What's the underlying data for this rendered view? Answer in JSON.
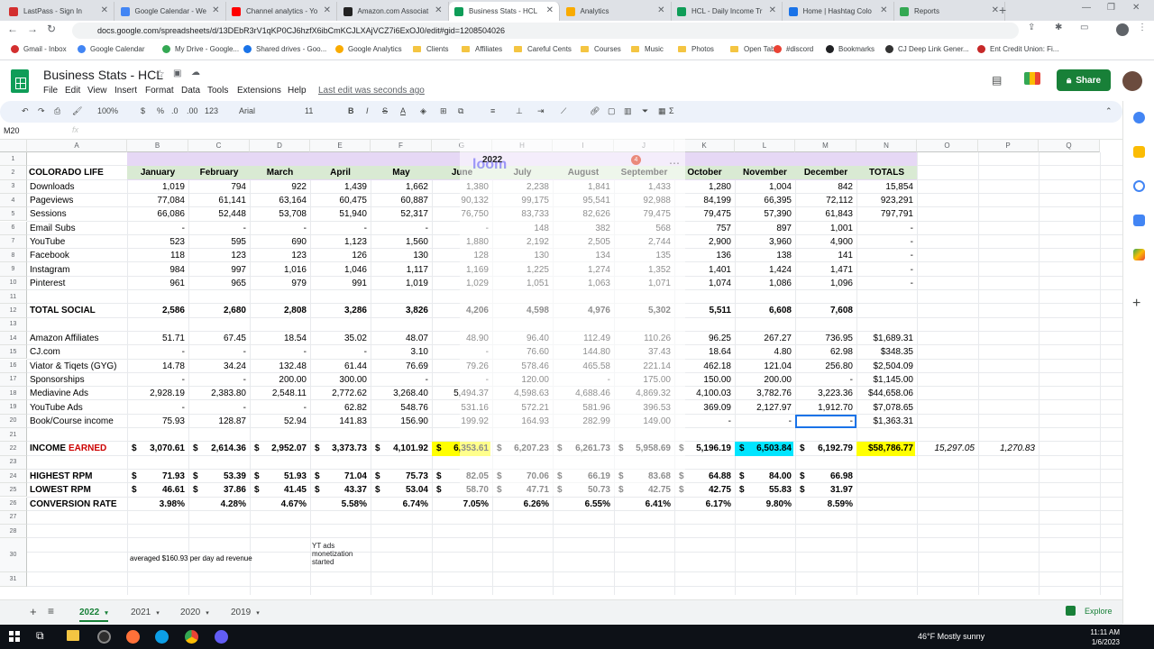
{
  "browser": {
    "tabs": [
      {
        "title": "LastPass - Sign In",
        "color": "#d32f2f"
      },
      {
        "title": "Google Calendar - We",
        "color": "#4285f4"
      },
      {
        "title": "Channel analytics - Yo",
        "color": "#ff0000"
      },
      {
        "title": "Amazon.com Associat",
        "color": "#222222"
      },
      {
        "title": "Business Stats - HCL",
        "color": "#0f9d58"
      },
      {
        "title": "Analytics",
        "color": "#f9ab00"
      },
      {
        "title": "HCL - Daily Income Tr",
        "color": "#0f9d58"
      },
      {
        "title": "Home | Hashtag Colo",
        "color": "#1a73e8"
      },
      {
        "title": "Reports",
        "color": "#34a853"
      }
    ],
    "url": "docs.google.com/spreadsheets/d/13DEbR3rV1qKP0CJ6hzfX6ibCmKCJLXAjVCZ7i6ExOJ0/edit#gid=1208504026",
    "bookmarks": [
      "Gmail - Inbox",
      "Google Calendar",
      "My Drive - Google...",
      "Shared drives - Goo...",
      "Google Analytics",
      "Clients",
      "Affiliates",
      "Careful Cents",
      "Courses",
      "Music",
      "Photos",
      "Open Tabs",
      "#discord",
      "Bookmarks",
      "CJ Deep Link Gener...",
      "Ent Credit Union: Fi..."
    ]
  },
  "doc": {
    "title": "Business Stats - HCL",
    "menus": [
      "File",
      "Edit",
      "View",
      "Insert",
      "Format",
      "Data",
      "Tools",
      "Extensions",
      "Help"
    ],
    "last_edit": "Last edit was seconds ago",
    "share_label": "Share"
  },
  "toolbar": {
    "zoom": "100%",
    "currency": "$",
    "percent": "%",
    "dec_less": ".0",
    "dec_more": ".00",
    "format": "123",
    "font": "Arial",
    "size": "11"
  },
  "formula": {
    "cell_ref": "M20",
    "fx": "fx"
  },
  "grid": {
    "columns": [
      "A",
      "B",
      "C",
      "D",
      "E",
      "F",
      "G",
      "H",
      "I",
      "J",
      "K",
      "L",
      "M",
      "N",
      "O",
      "P",
      "Q"
    ],
    "year_label": "2022",
    "header_row": [
      "COLORADO LIFE",
      "January",
      "February",
      "March",
      "April",
      "May",
      "June",
      "July",
      "August",
      "September",
      "October",
      "November",
      "December",
      "TOTALS"
    ],
    "rows": [
      {
        "n": "3",
        "label": "Downloads",
        "vals": [
          "1,019",
          "794",
          "922",
          "1,439",
          "1,662",
          "1,380",
          "2,238",
          "1,841",
          "1,433",
          "1,280",
          "1,004",
          "842",
          "15,854"
        ]
      },
      {
        "n": "4",
        "label": "Pageviews",
        "vals": [
          "77,084",
          "61,141",
          "63,164",
          "60,475",
          "60,887",
          "90,132",
          "99,175",
          "95,541",
          "92,988",
          "84,199",
          "66,395",
          "72,112",
          "923,291"
        ]
      },
      {
        "n": "5",
        "label": "Sessions",
        "vals": [
          "66,086",
          "52,448",
          "53,708",
          "51,940",
          "52,317",
          "76,750",
          "83,733",
          "82,626",
          "79,475",
          "79,475",
          "57,390",
          "61,843",
          "797,791"
        ]
      },
      {
        "n": "6",
        "label": "Email Subs",
        "vals": [
          "-",
          "-",
          "-",
          "-",
          "-",
          "-",
          "148",
          "382",
          "568",
          "757",
          "897",
          "1,001",
          "-"
        ]
      },
      {
        "n": "7",
        "label": "YouTube",
        "vals": [
          "523",
          "595",
          "690",
          "1,123",
          "1,560",
          "1,880",
          "2,192",
          "2,505",
          "2,744",
          "2,900",
          "3,960",
          "4,900",
          "-"
        ]
      },
      {
        "n": "8",
        "label": "Facebook",
        "vals": [
          "118",
          "123",
          "123",
          "126",
          "130",
          "128",
          "130",
          "134",
          "135",
          "136",
          "138",
          "141",
          "-"
        ]
      },
      {
        "n": "9",
        "label": "Instagram",
        "vals": [
          "984",
          "997",
          "1,016",
          "1,046",
          "1,117",
          "1,169",
          "1,225",
          "1,274",
          "1,352",
          "1,401",
          "1,424",
          "1,471",
          "-"
        ]
      },
      {
        "n": "10",
        "label": "Pinterest",
        "vals": [
          "961",
          "965",
          "979",
          "991",
          "1,019",
          "1,029",
          "1,051",
          "1,063",
          "1,071",
          "1,074",
          "1,086",
          "1,096",
          "-"
        ]
      },
      {
        "n": "12",
        "label": "TOTAL SOCIAL",
        "bold": true,
        "vals": [
          "2,586",
          "2,680",
          "2,808",
          "3,286",
          "3,826",
          "4,206",
          "4,598",
          "4,976",
          "5,302",
          "5,511",
          "6,608",
          "7,608",
          ""
        ]
      },
      {
        "n": "14",
        "label": "Amazon Affiliates",
        "vals": [
          "51.71",
          "67.45",
          "18.54",
          "35.02",
          "48.07",
          "48.90",
          "96.40",
          "112.49",
          "110.26",
          "96.25",
          "267.27",
          "736.95",
          "$1,689.31"
        ]
      },
      {
        "n": "15",
        "label": "CJ.com",
        "vals": [
          "-",
          "-",
          "-",
          "-",
          "3.10",
          "-",
          "76.60",
          "144.80",
          "37.43",
          "18.64",
          "4.80",
          "62.98",
          "$348.35"
        ]
      },
      {
        "n": "16",
        "label": "Viator & Tiqets (GYG)",
        "vals": [
          "14.78",
          "34.24",
          "132.48",
          "61.44",
          "76.69",
          "79.26",
          "578.46",
          "465.58",
          "221.14",
          "462.18",
          "121.04",
          "256.80",
          "$2,504.09"
        ]
      },
      {
        "n": "17",
        "label": "Sponsorships",
        "vals": [
          "-",
          "-",
          "200.00",
          "300.00",
          "-",
          "-",
          "120.00",
          "-",
          "175.00",
          "150.00",
          "200.00",
          "-",
          "$1,145.00"
        ]
      },
      {
        "n": "18",
        "label": "Mediavine Ads",
        "vals": [
          "2,928.19",
          "2,383.80",
          "2,548.11",
          "2,772.62",
          "3,268.40",
          "5,494.37",
          "4,598.63",
          "4,688.46",
          "4,869.32",
          "4,100.03",
          "3,782.76",
          "3,223.36",
          "$44,658.06"
        ]
      },
      {
        "n": "19",
        "label": "YouTube Ads",
        "vals": [
          "-",
          "-",
          "-",
          "62.82",
          "548.76",
          "531.16",
          "572.21",
          "581.96",
          "396.53",
          "369.09",
          "2,127.97",
          "1,912.70",
          "$7,078.65"
        ]
      },
      {
        "n": "20",
        "label": "Book/Course income",
        "vals": [
          "75.93",
          "128.87",
          "52.94",
          "141.83",
          "156.90",
          "199.92",
          "164.93",
          "282.99",
          "149.00",
          "-",
          "-",
          "-",
          "$1,363.31"
        ]
      },
      {
        "n": "22",
        "label": "INCOME",
        "label2": "EARNED",
        "bold": true,
        "dollar": true,
        "vals": [
          "3,070.61",
          "2,614.36",
          "2,952.07",
          "3,373.73",
          "4,101.92",
          "6,353.61",
          "6,207.23",
          "6,261.73",
          "5,958.69",
          "5,196.19",
          "6,503.84",
          "6,192.79",
          "$58,786.77"
        ],
        "extra": [
          "15,297.05",
          "1,270.83"
        ]
      },
      {
        "n": "24",
        "label": "HIGHEST RPM",
        "bold": true,
        "dollar": true,
        "vals": [
          "71.93",
          "53.39",
          "51.93",
          "71.04",
          "75.73",
          "82.05",
          "70.06",
          "66.19",
          "83.68",
          "64.88",
          "84.00",
          "66.98",
          ""
        ]
      },
      {
        "n": "25",
        "label": "LOWEST RPM",
        "bold": true,
        "dollar": true,
        "vals": [
          "46.61",
          "37.86",
          "41.45",
          "43.37",
          "53.04",
          "58.70",
          "47.71",
          "50.73",
          "42.75",
          "42.75",
          "55.83",
          "31.97",
          ""
        ]
      },
      {
        "n": "26",
        "label": "CONVERSION RATE",
        "bold": true,
        "vals": [
          "3.98%",
          "4.28%",
          "4.67%",
          "5.58%",
          "6.74%",
          "7.05%",
          "6.26%",
          "6.55%",
          "6.41%",
          "6.17%",
          "9.80%",
          "8.59%",
          ""
        ]
      }
    ],
    "empty_rows": [
      "1",
      "2",
      "11",
      "13",
      "21",
      "23",
      "27",
      "28",
      "29",
      "30",
      "31"
    ],
    "note_b30": "averaged $160.93 per day ad revenue",
    "note_e30": "YT ads monetization started"
  },
  "loom": {
    "brand": "loom",
    "badge": "4"
  },
  "sheet_tabs": [
    "2022",
    "2021",
    "2020",
    "2019"
  ],
  "explore_label": "Explore",
  "taskbar": {
    "weather": "46°F  Mostly sunny",
    "time": "11:11 AM",
    "date": "1/6/2023"
  },
  "colors": {
    "yellow": "#ffff00",
    "cyan": "#00e5ff",
    "lavender": "#e6d8f5",
    "green_hdr": "#d9ead3",
    "red": "#cc0000"
  }
}
